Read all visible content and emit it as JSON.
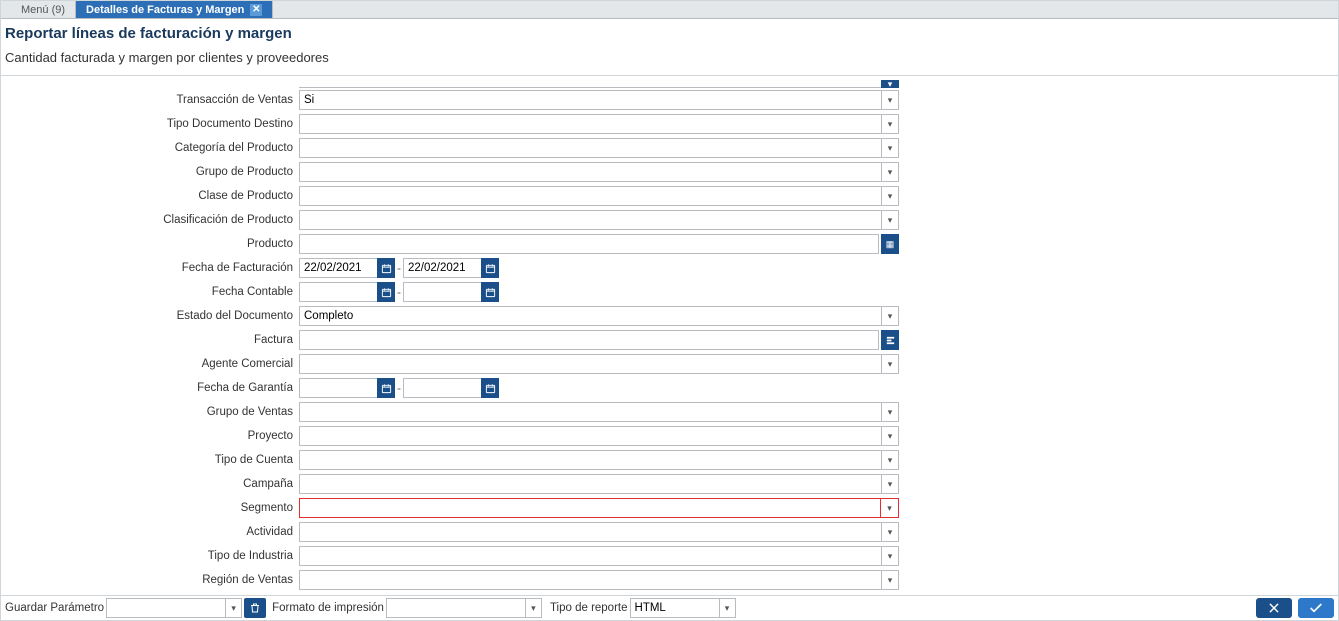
{
  "tabs": {
    "menu_label": "Menú (9)",
    "active_label": "Detalles de Facturas y Margen"
  },
  "header": {
    "title": "Reportar líneas de facturación y margen",
    "subtitle": "Cantidad facturada y margen por clientes y proveedores"
  },
  "fields": {
    "transaccion_ventas": {
      "label": "Transacción de Ventas",
      "value": "Si"
    },
    "tipo_doc_destino": {
      "label": "Tipo Documento Destino",
      "value": ""
    },
    "categoria_producto": {
      "label": "Categoría del Producto",
      "value": ""
    },
    "grupo_producto": {
      "label": "Grupo de Producto",
      "value": ""
    },
    "clase_producto": {
      "label": "Clase de Producto",
      "value": ""
    },
    "clasificacion_producto": {
      "label": "Clasificación de Producto",
      "value": ""
    },
    "producto": {
      "label": "Producto",
      "value": ""
    },
    "fecha_facturacion": {
      "label": "Fecha de Facturación",
      "from": "22/02/2021",
      "to": "22/02/2021"
    },
    "fecha_contable": {
      "label": "Fecha Contable",
      "from": "",
      "to": ""
    },
    "estado_documento": {
      "label": "Estado del Documento",
      "value": "Completo"
    },
    "factura": {
      "label": "Factura",
      "value": ""
    },
    "agente_comercial": {
      "label": "Agente Comercial",
      "value": ""
    },
    "fecha_garantia": {
      "label": "Fecha de Garantía",
      "from": "",
      "to": ""
    },
    "grupo_ventas": {
      "label": "Grupo de Ventas",
      "value": ""
    },
    "proyecto": {
      "label": "Proyecto",
      "value": ""
    },
    "tipo_cuenta": {
      "label": "Tipo de Cuenta",
      "value": ""
    },
    "campana": {
      "label": "Campaña",
      "value": ""
    },
    "segmento": {
      "label": "Segmento",
      "value": ""
    },
    "actividad": {
      "label": "Actividad",
      "value": ""
    },
    "tipo_industria": {
      "label": "Tipo de Industria",
      "value": ""
    },
    "region_ventas": {
      "label": "Región de Ventas",
      "value": ""
    }
  },
  "footer": {
    "guardar_parametro_label": "Guardar Parámetro",
    "guardar_parametro_value": "",
    "formato_impresion_label": "Formato de impresión",
    "formato_impresion_value": "",
    "tipo_reporte_label": "Tipo de reporte",
    "tipo_reporte_value": "HTML"
  },
  "icons": {
    "chevron_down": "▾",
    "calendar": "📅",
    "grid": "▦",
    "search_arrow": "⟵",
    "trash": "🗑",
    "x": "✕",
    "check": "✓",
    "close_tab": "✕",
    "dash": "-"
  }
}
